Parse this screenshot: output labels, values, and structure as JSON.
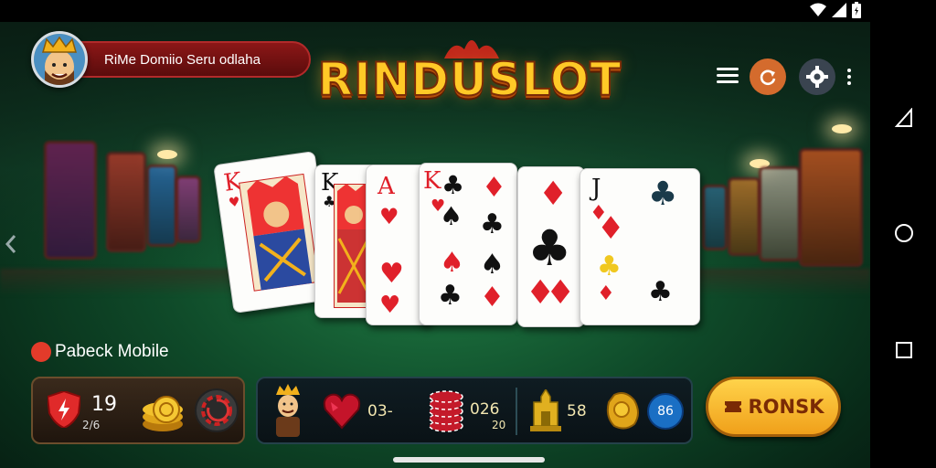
{
  "profile": {
    "name": "RiMe Domiio Seru odlaha"
  },
  "logo": {
    "text": "RINDUSLOT"
  },
  "header": {
    "menu_icon": "hamburger-icon",
    "refresh_icon": "refresh-icon",
    "settings_icon": "gear-icon",
    "more_icon": "more-vert-icon"
  },
  "cards": [
    {
      "rank": "K",
      "suit": "heart"
    },
    {
      "rank": "K",
      "suit": "club"
    },
    {
      "rank": "A",
      "suit": "heart"
    },
    {
      "rank": "K",
      "suit": "club"
    },
    {
      "rank": "",
      "suit": "diamond"
    },
    {
      "rank": "J",
      "suit": "club"
    }
  ],
  "brand": {
    "label": "Pabeck Mobile"
  },
  "left_panel": {
    "level": "19",
    "sublabel": "2/6"
  },
  "mid_panel": {
    "hearts_value": "03-",
    "chips_value": "026",
    "chips_sub": "20",
    "trophy_value": "58",
    "badge_value": "86"
  },
  "bonus_button": {
    "label": "RONSK"
  },
  "colors": {
    "accent": "#ffc927",
    "felt": "#1f7a43",
    "bonus": "#f0a01a"
  }
}
